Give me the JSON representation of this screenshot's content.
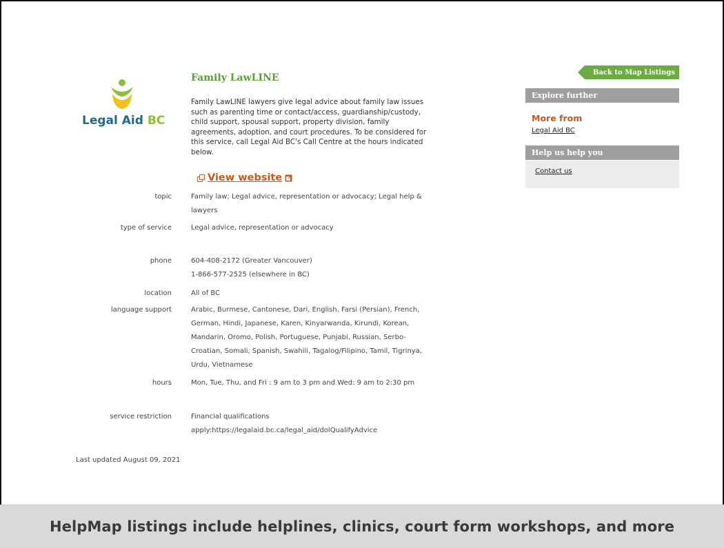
{
  "listing": {
    "title": "Family LawLINE",
    "description": "Family LawLINE lawyers give legal advice about family law issues such as parenting time or contact/access, guardianship/custody, child support, spousal support, property division, family agreements, adoption, and court procedures. To be considered for this service, call Legal Aid BC's Call Centre at the hours indicated below.",
    "view_website_label": "View website",
    "logo": {
      "text_part1": "Legal Aid",
      "text_part2": "BC",
      "brand_blue": "#1e6b8a",
      "brand_green": "#8cbf3a",
      "brand_yellow": "#f2c21a"
    }
  },
  "fields": {
    "topic": {
      "label": "topic",
      "value": "Family law; Legal advice, representation or advocacy; Legal help & lawyers"
    },
    "type": {
      "label": "type of service",
      "value": "Legal advice, representation or advocacy"
    },
    "phone": {
      "label": "phone",
      "line1": "604-408-2172 (Greater Vancouver)",
      "line2": "1-866-577-2525 (elsewhere in BC)"
    },
    "location": {
      "label": "location",
      "value": "All of BC"
    },
    "language": {
      "label": "language support",
      "value": "Arabic, Burmese, Cantonese, Dari, English, Farsi (Persian), French, German, Hindi, Japanese, Karen, Kinyarwanda, Kirundi, Korean, Mandarin, Oromo, Polish, Portuguese, Punjabi, Russian, Serbo-Croatian, Somali, Spanish, Swahili, Tagalog/Filipino, Tamil, Tigrinya, Urdu, Vietnamese"
    },
    "hours": {
      "label": "hours",
      "value": "Mon, Tue, Thu, and Fri : 9 am to 3 pm and Wed: 9 am to 2:30 pm"
    },
    "restriction": {
      "label": "service restriction",
      "line1": "Financial qualifications",
      "line2": "apply:https://legalaid.bc.ca/legal_aid/dolQualifyAdvice"
    }
  },
  "last_updated": "Last updated August 09, 2021",
  "sidebar": {
    "back_label": "Back to Map Listings",
    "explore_heading": "Explore further",
    "more_from_label": "More from",
    "more_from_link": "Legal Aid BC",
    "help_heading": "Help us help you",
    "contact_link": "Contact us",
    "accent_green": "#6cab41",
    "accent_orange": "#c8581c"
  },
  "footer_caption": "HelpMap listings include helplines, clinics, court form workshops, and more"
}
